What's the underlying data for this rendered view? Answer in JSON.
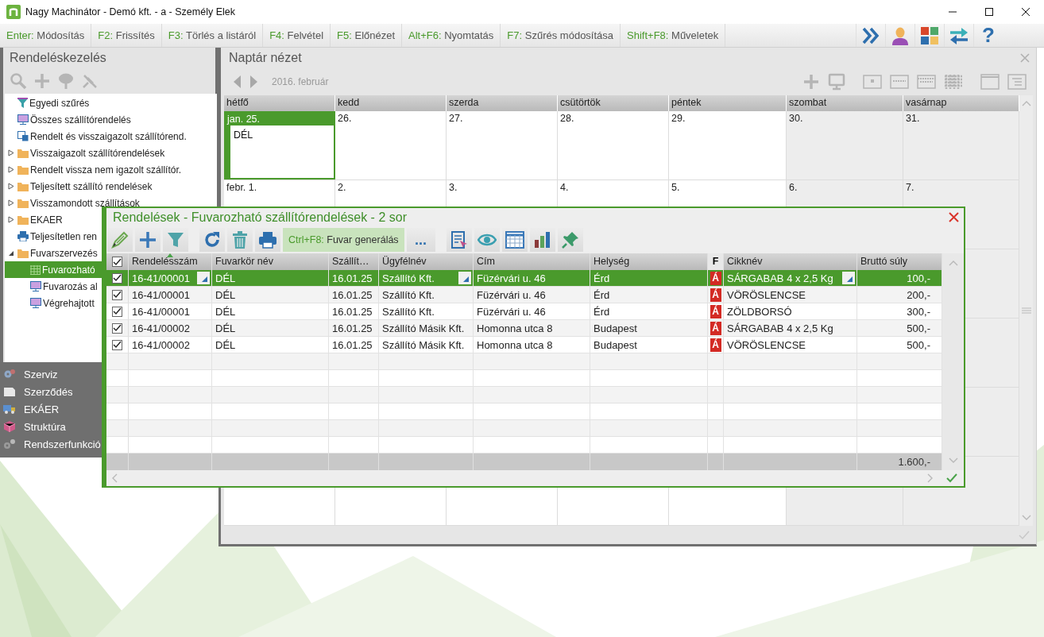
{
  "window": {
    "title": "Nagy Machinátor - Demó kft. - a - Személy Elek"
  },
  "shortcuts": [
    {
      "key": "Enter:",
      "label": "Módosítás"
    },
    {
      "key": "F2:",
      "label": "Frissítés"
    },
    {
      "key": "F3:",
      "label": "Törlés a listáról"
    },
    {
      "key": "F4:",
      "label": "Felvétel"
    },
    {
      "key": "F5:",
      "label": "Előnézet"
    },
    {
      "key": "Alt+F6:",
      "label": "Nyomtatás"
    },
    {
      "key": "F7:",
      "label": "Szűrés módosítása"
    },
    {
      "key": "Shift+F8:",
      "label": "Műveletek"
    }
  ],
  "help": "?",
  "side_panel": {
    "title": "Rendeléskezelés",
    "tree": [
      {
        "label": "Egyedi szűrés",
        "kind": "filter",
        "selected": false
      },
      {
        "label": "Összes szállítórendelés",
        "kind": "view",
        "selected": false
      },
      {
        "label": "Rendelt és visszaigazolt szállítórend.",
        "kind": "report",
        "selected": false
      },
      {
        "label": "Visszaigazolt szállítórendelések",
        "kind": "folder",
        "expanded": false,
        "selected": false
      },
      {
        "label": "Rendelt vissza nem igazolt szállítór.",
        "kind": "folder",
        "expanded": false,
        "selected": false
      },
      {
        "label": "Teljesített szállító rendelések",
        "kind": "folder",
        "expanded": false,
        "selected": false
      },
      {
        "label": "Visszamondott szállítások",
        "kind": "folder",
        "expanded": false,
        "selected": false
      },
      {
        "label": "EKAER",
        "kind": "folder",
        "expanded": false,
        "selected": false
      },
      {
        "label": "Teljesítetlen ren",
        "kind": "print",
        "selected": false
      },
      {
        "label": "Fuvarszervezés",
        "kind": "folder",
        "expanded": true,
        "selected": false,
        "children": [
          {
            "label": "Fuvarozható",
            "kind": "grid",
            "selected": true
          },
          {
            "label": "Fuvarozás al",
            "kind": "view",
            "selected": false
          },
          {
            "label": "Végrehajtott",
            "kind": "view",
            "selected": false
          }
        ]
      }
    ]
  },
  "modules": [
    {
      "label": "Szerviz"
    },
    {
      "label": "Szerződés"
    },
    {
      "label": "EKÁER"
    },
    {
      "label": "Struktúra"
    },
    {
      "label": "Rendszerfunkció"
    }
  ],
  "calendar": {
    "title": "Naptár nézet",
    "month": "2016. február",
    "days": [
      {
        "label": "hétfő",
        "weekend": false
      },
      {
        "label": "kedd",
        "weekend": false
      },
      {
        "label": "szerda",
        "weekend": false
      },
      {
        "label": "csütörtök",
        "weekend": false
      },
      {
        "label": "péntek",
        "weekend": false
      },
      {
        "label": "szombat",
        "weekend": true
      },
      {
        "label": "vasárnap",
        "weekend": true
      }
    ],
    "weeks": [
      {
        "cells": [
          {
            "date": "jan. 25.",
            "selected": true,
            "events": [
              "DÉL"
            ]
          },
          {
            "date": "26.",
            "selected": false
          },
          {
            "date": "27.",
            "selected": false
          },
          {
            "date": "28.",
            "selected": false
          },
          {
            "date": "29.",
            "selected": false
          },
          {
            "date": "30.",
            "selected": false
          },
          {
            "date": "31.",
            "selected": false
          }
        ]
      },
      {
        "cells": [
          {
            "date": "febr. 1.",
            "selected": false
          },
          {
            "date": "2.",
            "selected": false
          },
          {
            "date": "3.",
            "selected": false
          },
          {
            "date": "4.",
            "selected": false
          },
          {
            "date": "5.",
            "selected": false
          },
          {
            "date": "6.",
            "selected": false
          },
          {
            "date": "7.",
            "selected": false
          }
        ]
      }
    ]
  },
  "dialog": {
    "title": "Rendelések - Fuvarozható szállítórendelések - 2 sor",
    "generate_button": {
      "key": "Ctrl+F8:",
      "label": "Fuvar generálás"
    },
    "more_button": "...",
    "table": {
      "all_checked": true,
      "columns": [
        {
          "label": "Rendelésszám",
          "sorted": true,
          "dropdown": true
        },
        {
          "label": "Fuvarkör név",
          "sorted": false
        },
        {
          "label": "Szállít…",
          "sorted": false
        },
        {
          "label": "Ügyfélnév",
          "sorted": false,
          "dropdown": true
        },
        {
          "label": "Cím",
          "sorted": false
        },
        {
          "label": "Helység",
          "sorted": false
        },
        {
          "label": "F",
          "sorted": false
        },
        {
          "label": "Cikknév",
          "sorted": false,
          "dropdown": true
        },
        {
          "label": "Bruttó súly",
          "sorted": false
        }
      ],
      "rows": [
        {
          "checked": true,
          "selected": true,
          "cells": [
            "16-41/00001",
            "DÉL",
            "16.01.25",
            "Szállító Kft.",
            "Füzérvári u. 46",
            "Érd",
            "Á",
            "SÁRGABAB 4 x 2,5 Kg",
            "100,-"
          ]
        },
        {
          "checked": true,
          "selected": false,
          "cells": [
            "16-41/00001",
            "DÉL",
            "16.01.25",
            "Szállító Kft.",
            "Füzérvári u. 46",
            "Érd",
            "Á",
            "VÖRÖSLENCSE",
            "200,-"
          ]
        },
        {
          "checked": true,
          "selected": false,
          "cells": [
            "16-41/00001",
            "DÉL",
            "16.01.25",
            "Szállító Kft.",
            "Füzérvári u. 46",
            "Érd",
            "Á",
            "ZÖLDBORSÓ",
            "300,-"
          ]
        },
        {
          "checked": true,
          "selected": false,
          "cells": [
            "16-41/00002",
            "DÉL",
            "16.01.25",
            "Szállító Másik Kft.",
            "Homonna utca 8",
            "Budapest",
            "Á",
            "SÁRGABAB 4 x 2,5 Kg",
            "500,-"
          ]
        },
        {
          "checked": true,
          "selected": false,
          "cells": [
            "16-41/00002",
            "DÉL",
            "16.01.25",
            "Szállító Másik Kft.",
            "Homonna utca 8",
            "Budapest",
            "Á",
            "VÖRÖSLENCSE",
            "500,-"
          ]
        }
      ],
      "total": "1.600,-"
    }
  }
}
